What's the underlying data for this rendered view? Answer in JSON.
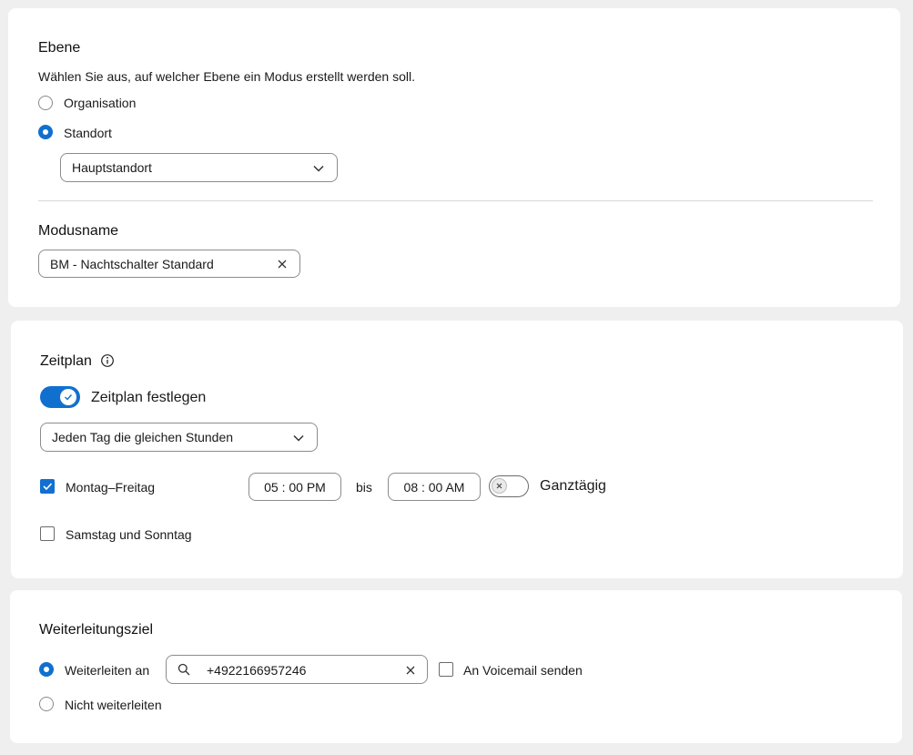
{
  "ebene": {
    "title": "Ebene",
    "description": "Wählen Sie aus, auf welcher Ebene ein Modus erstellt werden soll.",
    "options": [
      {
        "label": "Organisation",
        "selected": false
      },
      {
        "label": "Standort",
        "selected": true
      }
    ],
    "location_select": {
      "value": "Hauptstandort",
      "icon": "chevron-down-icon"
    }
  },
  "modusname": {
    "title": "Modusname",
    "value": "BM - Nachtschalter Standard",
    "clear_icon": "close-icon"
  },
  "zeitplan": {
    "title": "Zeitplan",
    "info_icon": "info-icon",
    "toggle": {
      "label": "Zeitplan festlegen",
      "on": true
    },
    "schedule_select": {
      "value": "Jeden Tag die gleichen Stunden"
    },
    "weekdays": {
      "label": "Montag–Freitag",
      "checked": true,
      "start": "05 : 00 PM",
      "separator": "bis",
      "end": "08 : 00 AM",
      "all_day_label": "Ganztägig",
      "all_day_on": false
    },
    "weekend": {
      "label": "Samstag und Sonntag",
      "checked": false
    }
  },
  "weiterleitung": {
    "title": "Weiterleitungsziel",
    "forward": {
      "label": "Weiterleiten an",
      "selected": true,
      "number": "+4922166957246"
    },
    "voicemail": {
      "label": "An Voicemail senden",
      "checked": false
    },
    "no_forward": {
      "label": "Nicht weiterleiten",
      "selected": false
    }
  },
  "colors": {
    "accent": "#1170cf",
    "border": "#8c8c8c",
    "background": "#efefef",
    "card": "#ffffff"
  }
}
